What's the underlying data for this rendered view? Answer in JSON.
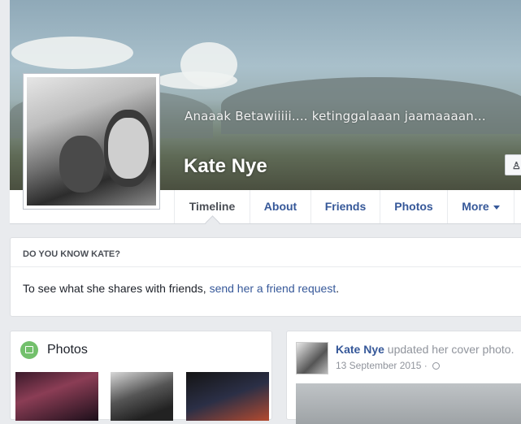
{
  "profile": {
    "cover_caption": "Anaaak Betawiiiii.... ketinggalaaan jaamaaaan...",
    "name": "Kate Nye",
    "add_friend_label": "A"
  },
  "nav": {
    "tabs": [
      {
        "label": "Timeline",
        "active": true
      },
      {
        "label": "About"
      },
      {
        "label": "Friends"
      },
      {
        "label": "Photos"
      },
      {
        "label": "More"
      }
    ]
  },
  "do_you_know": {
    "heading": "DO YOU KNOW KATE?",
    "text": "To see what she shares with friends, ",
    "link": "send her a friend request",
    "period": "."
  },
  "photos": {
    "title": "Photos"
  },
  "post": {
    "author": "Kate Nye",
    "action": " updated her cover photo.",
    "date": "13 September 2015 · "
  },
  "colors": {
    "link": "#365899",
    "background": "#e9ebee",
    "photos_icon": "#73c06c"
  }
}
